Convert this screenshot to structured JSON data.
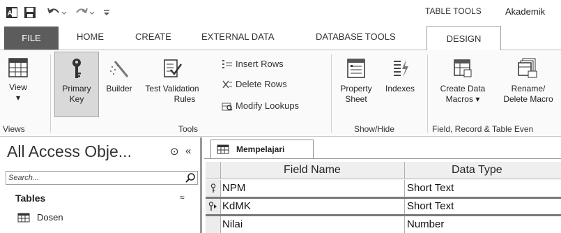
{
  "quick_access": {
    "app_icon": "access-logo-icon",
    "save_icon": "save-icon",
    "undo_icon": "undo-icon",
    "redo_icon": "redo-icon",
    "customize_icon": "customize-toolbar-icon"
  },
  "context_group_label": "TABLE TOOLS",
  "app_title": "Akademik",
  "tabs": {
    "file": "FILE",
    "home": "HOME",
    "create": "CREATE",
    "external": "EXTERNAL DATA",
    "database_tools": "DATABASE TOOLS",
    "design": "DESIGN"
  },
  "ribbon": {
    "views": {
      "view_label": "View",
      "dropdown": "▾",
      "group": "Views"
    },
    "tools": {
      "primary_key_line1": "Primary",
      "primary_key_line2": "Key",
      "builder": "Builder",
      "test_validation_line1": "Test Validation",
      "test_validation_line2": "Rules",
      "insert_rows": "Insert Rows",
      "delete_rows": "Delete Rows",
      "modify_lookups": "Modify Lookups",
      "group": "Tools"
    },
    "show_hide": {
      "property_sheet_line1": "Property",
      "property_sheet_line2": "Sheet",
      "indexes": "Indexes",
      "group": "Show/Hide"
    },
    "field_record": {
      "create_data_macros_line1": "Create Data",
      "create_data_macros_line2": "Macros ▾",
      "rename_delete_line1": "Rename/",
      "rename_delete_line2": "Delete Macro",
      "group": "Field, Record & Table Even"
    }
  },
  "nav": {
    "title": "All Access Obje...",
    "menu_glyph": "⊙",
    "shutter_glyph": "«",
    "search_placeholder": "Search...",
    "section": "Tables",
    "collapse_glyph": "≈",
    "items": [
      {
        "label": "Dosen"
      }
    ]
  },
  "document": {
    "tab_label": "Mempelajari",
    "columns": {
      "field_name": "Field Name",
      "data_type": "Data Type"
    },
    "rows": [
      {
        "field": "NPM",
        "type": "Short Text",
        "key": true,
        "current": false
      },
      {
        "field": "KdMK",
        "type": "Short Text",
        "key": true,
        "current": true
      },
      {
        "field": "Nilai",
        "type": "Number",
        "key": false,
        "current": false
      }
    ]
  }
}
